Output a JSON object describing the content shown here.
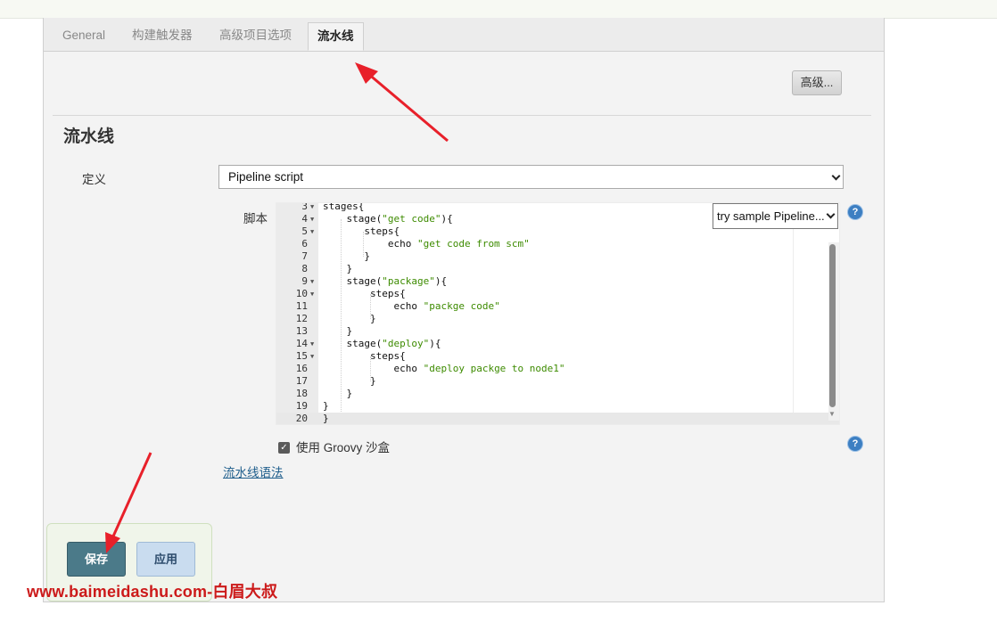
{
  "tabs": [
    {
      "label": "General"
    },
    {
      "label": "构建触发器"
    },
    {
      "label": "高级项目选项"
    },
    {
      "label": "流水线"
    }
  ],
  "advanced_button": "高级...",
  "section_title": "流水线",
  "definition": {
    "label": "定义",
    "value": "Pipeline script"
  },
  "script": {
    "label": "脚本",
    "sample_select": "try sample Pipeline...",
    "lines": [
      {
        "n": "3",
        "fold": "▼",
        "text": "stages{"
      },
      {
        "n": "4",
        "fold": "▼",
        "text": "    stage(",
        "s": "\"get code\"",
        "tail": "){"
      },
      {
        "n": "5",
        "fold": "▼",
        "text": "       steps{"
      },
      {
        "n": "6",
        "fold": "",
        "text": "           echo ",
        "s": "\"get code from scm\"",
        "tail": ""
      },
      {
        "n": "7",
        "fold": "",
        "text": "       }"
      },
      {
        "n": "8",
        "fold": "",
        "text": "    }"
      },
      {
        "n": "9",
        "fold": "▼",
        "text": "    stage(",
        "s": "\"package\"",
        "tail": "){"
      },
      {
        "n": "10",
        "fold": "▼",
        "text": "        steps{"
      },
      {
        "n": "11",
        "fold": "",
        "text": "            echo ",
        "s": "\"packge code\"",
        "tail": ""
      },
      {
        "n": "12",
        "fold": "",
        "text": "        }"
      },
      {
        "n": "13",
        "fold": "",
        "text": "    }"
      },
      {
        "n": "14",
        "fold": "▼",
        "text": "    stage(",
        "s": "\"deploy\"",
        "tail": "){"
      },
      {
        "n": "15",
        "fold": "▼",
        "text": "        steps{"
      },
      {
        "n": "16",
        "fold": "",
        "text": "            echo ",
        "s": "\"deploy packge to node1\"",
        "tail": ""
      },
      {
        "n": "17",
        "fold": "",
        "text": "        }"
      },
      {
        "n": "18",
        "fold": "",
        "text": "    }"
      },
      {
        "n": "19",
        "fold": "",
        "text": "}"
      },
      {
        "n": "20",
        "fold": "",
        "text": "}"
      }
    ]
  },
  "groovy_sandbox": {
    "label": "使用 Groovy 沙盒",
    "checked": true
  },
  "pipeline_syntax_link": "流水线语法",
  "buttons": {
    "save": "保存",
    "apply": "应用"
  },
  "help_glyph": "?",
  "watermark": "www.baimeidashu.com-白眉大叔",
  "colors": {
    "save_bg": "#4b7a89",
    "apply_bg": "#c9dcef",
    "arrow": "#e8202a",
    "string": "#3d8b00"
  }
}
